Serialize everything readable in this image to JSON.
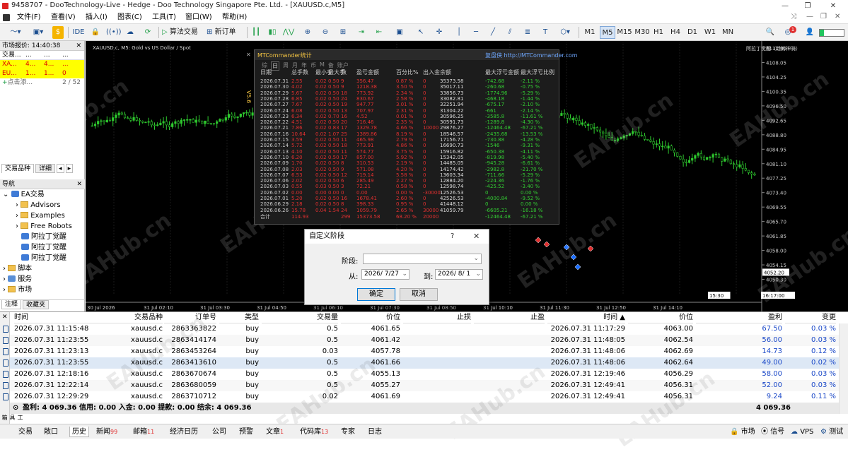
{
  "window": {
    "title": "9458707 - DooTechnology-Live - Hedge - Doo Technology Singapore Pte. Ltd. - [XAUUSD.c,M5]"
  },
  "menu": [
    "文件(F)",
    "查看(V)",
    "插入(I)",
    "图表(C)",
    "工具(T)",
    "窗口(W)",
    "帮助(H)"
  ],
  "toolbar": {
    "ide": "IDE",
    "algo_trading": "算法交易",
    "new_order": "新订单",
    "timeframes": [
      "M1",
      "M5",
      "M15",
      "M30",
      "H1",
      "H4",
      "D1",
      "W1",
      "MN"
    ],
    "active_timeframe": "M5",
    "notify_count": "1"
  },
  "market_watch": {
    "title": "市场报价: 14:40:38",
    "headers": [
      "交易...",
      "...",
      "...",
      "..."
    ],
    "rows": [
      {
        "symbol": "XA...",
        "bid": "4...",
        "ask": "4...",
        "spread": "..."
      },
      {
        "symbol": "EU...",
        "bid": "1...",
        "ask": "1...",
        "spread": "0"
      }
    ],
    "add": "点击添...",
    "count": "2 / 52",
    "tabs": [
      "交易品种",
      "详细"
    ]
  },
  "navigator": {
    "title": "导航",
    "items": [
      "EA交易",
      "Advisors",
      "Examples",
      "Free Robots",
      "阿拉丁觉醒",
      "阿拉丁觉醒",
      "阿拉丁觉醒",
      "脚本",
      "服务",
      "市场"
    ],
    "tabs": [
      "注释",
      "收藏夹"
    ]
  },
  "chart": {
    "symbol_label": "XAUUSD.c, M5:  Gold vs US Dollar / Spot",
    "ea_label": "阿拉丁觉醒（趋势神骑）",
    "price_ticks": [
      "4111.90",
      "4108.05",
      "4104.25",
      "4100.35",
      "4096.50",
      "4092.65",
      "4088.80",
      "4084.95",
      "4081.10",
      "4077.25",
      "4073.40",
      "4069.55",
      "4065.70",
      "4061.85",
      "4058.00",
      "4054.15",
      "4050.30",
      "4046.45"
    ],
    "current_price": "4052.20",
    "time_ticks": [
      "30 Jul 2026",
      "31 Jul 02:10",
      "31 Jul 03:30",
      "31 Jul 04:50",
      "31 Jul 06:10",
      "31 Jul 07:30",
      "31 Jul 08:50",
      "31 Jul 10:10",
      "31 Jul 11:30",
      "31 Jul 12:50",
      "31 Jul 14:10"
    ],
    "time_markers": [
      "15:30",
      "16:17:00"
    ]
  },
  "mtc": {
    "title": "MTCommander统计",
    "link": "复盘侠 http://MTCommander.com",
    "tabs": [
      "综",
      "日",
      "周",
      "月",
      "年",
      "币",
      "M",
      "备",
      "账户"
    ],
    "headers": [
      "日期",
      "总手数",
      "最小手",
      "最大手",
      "数",
      "盈亏金额",
      "百分比%",
      "出入金",
      "余额",
      "最大浮亏金额",
      "最大浮亏比例"
    ],
    "rows": [
      [
        "2026.07.31",
        "2.55",
        "0.02",
        "0.50",
        "9",
        "356.47",
        "0.87 %",
        "0",
        "35373.58",
        "-742.68",
        "-2.11 %"
      ],
      [
        "2026.07.30",
        "4.02",
        "0.02",
        "0.50",
        "9",
        "1218.38",
        "3.50 %",
        "0",
        "35017.11",
        "-260.68",
        "-0.75 %"
      ],
      [
        "2026.07.29",
        "5.67",
        "0.02",
        "0.50",
        "18",
        "773.92",
        "2.34 %",
        "0",
        "33856.73",
        "-1774.96",
        "-5.29 %"
      ],
      [
        "2026.07.28",
        "6.85",
        "0.02",
        "0.50",
        "24",
        "830.67",
        "2.58 %",
        "0",
        "33082.81",
        "-468.18",
        "-1.44 %"
      ],
      [
        "2026.07.27",
        "7.67",
        "0.02",
        "0.50",
        "19",
        "947.77",
        "3.01 %",
        "0",
        "32251.94",
        "-675.17",
        "-2.10 %"
      ],
      [
        "2026.07.24",
        "6.08",
        "0.02",
        "0.50",
        "13",
        "707.97",
        "2.31 %",
        "0",
        "31304.22",
        "-661",
        "-2.14 %"
      ],
      [
        "2026.07.23",
        "6.34",
        "0.02",
        "0.70",
        "16",
        "4.52",
        "0.01 %",
        "0",
        "30596.25",
        "-3585.8",
        "-11.61 %"
      ],
      [
        "2026.07.22",
        "4.51",
        "0.02",
        "0.50",
        "20",
        "716.46",
        "2.35 %",
        "0",
        "30591.73",
        "-1289.8",
        "-4.30 %"
      ],
      [
        "2026.07.21",
        "7.86",
        "0.02",
        "0.83",
        "17",
        "1329.78",
        "4.66 %",
        "10000",
        "29876.27",
        "-12464.48",
        "-67.21 %"
      ],
      [
        "2026.07.16",
        "10.64",
        "0.02",
        "1.07",
        "25",
        "1389.86",
        "8.19 %",
        "0",
        "18546.57",
        "-2435.68",
        "-13.53 %"
      ],
      [
        "2026.07.15",
        "3.59",
        "0.02",
        "0.50",
        "11",
        "465.98",
        "2.79 %",
        "0",
        "17156.71",
        "-730.88",
        "-4.28 %"
      ],
      [
        "2026.07.14",
        "5.72",
        "0.02",
        "0.50",
        "18",
        "773.91",
        "4.86 %",
        "0",
        "16690.73",
        "-1546",
        "-9.31 %"
      ],
      [
        "2026.07.13",
        "4.10",
        "0.02",
        "0.50",
        "11",
        "574.77",
        "3.75 %",
        "0",
        "15916.82",
        "-650.38",
        "-4.11 %"
      ],
      [
        "2026.07.10",
        "6.20",
        "0.02",
        "0.50",
        "17",
        "857.00",
        "5.92 %",
        "0",
        "15342.05",
        "-819.98",
        "-5.40 %"
      ],
      [
        "2026.07.09",
        "1.70",
        "0.02",
        "0.50",
        "8",
        "310.53",
        "2.19 %",
        "0",
        "14485.05",
        "-945.28",
        "-6.61 %"
      ],
      [
        "2026.07.08",
        "2.03",
        "0.02",
        "0.50",
        "9",
        "571.08",
        "4.20 %",
        "0",
        "14174.42",
        "-2982.8",
        "-21.70 %"
      ],
      [
        "2026.07.07",
        "6.53",
        "0.02",
        "0.50",
        "12",
        "719.14",
        "5.58 %",
        "0",
        "13603.34",
        "-711.66",
        "-5.29 %"
      ],
      [
        "2026.07.06",
        "2.02",
        "0.02",
        "0.50",
        "6",
        "285.49",
        "2.27 %",
        "0",
        "12884.20",
        "-224.36",
        "-1.76 %"
      ],
      [
        "2026.07.03",
        "0.55",
        "0.03",
        "0.50",
        "3",
        "72.21",
        "0.58 %",
        "0",
        "12598.74",
        "-425.52",
        "-3.40 %"
      ],
      [
        "2026.07.02",
        "0.00",
        "0.00",
        "0.00",
        "0",
        "0.00",
        "0.00 %",
        "-30000",
        "12526.53",
        "0",
        "0.00 %"
      ],
      [
        "2026.07.01",
        "5.20",
        "0.02",
        "0.50",
        "16",
        "1678.41",
        "2.60 %",
        "0",
        "42526.53",
        "-4000.84",
        "-9.52 %"
      ],
      [
        "2026.06.29",
        "2.18",
        "0.02",
        "0.50",
        "8",
        "398.33",
        "0.95 %",
        "0",
        "41448.12",
        "0",
        "0.00 %"
      ],
      [
        "2026.06.26",
        "15.78",
        "0.04",
        "1.54",
        "24",
        "1059.79",
        "2.65 %",
        "30000",
        "41059.79",
        "-6605.21",
        "-16.18 %"
      ]
    ],
    "total": [
      "合计",
      "114.93",
      "",
      "",
      "299",
      "15373.58",
      "68.20 %",
      "20000",
      "",
      "-12464.48",
      "-67.21 %"
    ]
  },
  "dialog": {
    "title": "自定义阶段",
    "help": "?",
    "stage_label": "阶段:",
    "from_label": "从:",
    "from_value": "2026/ 7/27",
    "to_label": "到:",
    "to_value": "2026/ 8/ 1",
    "ok": "确定",
    "cancel": "取消"
  },
  "history": {
    "headers": [
      "时间",
      "交易品种",
      "订单号",
      "类型",
      "交易量",
      "价位",
      "止损",
      "止盈",
      "时间 ▲",
      "价位",
      "盈利",
      "变更"
    ],
    "rows": [
      [
        "2026.07.31 11:15:48",
        "xauusd.c",
        "2863363822",
        "buy",
        "0.5",
        "4061.65",
        "",
        "",
        "2026.07.31 11:17:29",
        "4063.00",
        "67.50",
        "0.03 %"
      ],
      [
        "2026.07.31 11:23:55",
        "xauusd.c",
        "2863414174",
        "buy",
        "0.5",
        "4061.42",
        "",
        "",
        "2026.07.31 11:48:05",
        "4062.54",
        "56.00",
        "0.03 %"
      ],
      [
        "2026.07.31 11:23:13",
        "xauusd.c",
        "2863453264",
        "buy",
        "0.03",
        "4057.78",
        "",
        "",
        "2026.07.31 11:48:06",
        "4062.69",
        "14.73",
        "0.12 %"
      ],
      [
        "2026.07.31 11:23:55",
        "xauusd.c",
        "2863413610",
        "buy",
        "0.5",
        "4061.66",
        "",
        "",
        "2026.07.31 11:48:06",
        "4062.64",
        "49.00",
        "0.02 %"
      ],
      [
        "2026.07.31 12:18:16",
        "xauusd.c",
        "2863670674",
        "buy",
        "0.5",
        "4055.13",
        "",
        "",
        "2026.07.31 12:19:46",
        "4056.29",
        "58.00",
        "0.03 %"
      ],
      [
        "2026.07.31 12:22:14",
        "xauusd.c",
        "2863680059",
        "buy",
        "0.5",
        "4055.27",
        "",
        "",
        "2026.07.31 12:49:41",
        "4056.31",
        "52.00",
        "0.03 %"
      ],
      [
        "2026.07.31 12:29:29",
        "xauusd.c",
        "2863710712",
        "buy",
        "0.02",
        "4061.69",
        "",
        "",
        "2026.07.31 12:49:41",
        "4056.31",
        "9.24",
        "0.11 %"
      ]
    ],
    "summary": "盈利: 4 069.36  信用: 0.00  入金: 0.00  提款: 0.00  结余: 4 069.36",
    "summary_total": "4 069.36",
    "side_label": "工具箱"
  },
  "bottom_tabs": [
    {
      "label": "交易"
    },
    {
      "label": "敞口"
    },
    {
      "label": "历史"
    },
    {
      "label": "新闻",
      "badge": "99"
    },
    {
      "label": "邮箱",
      "badge": "11"
    },
    {
      "label": "经济日历"
    },
    {
      "label": "公司"
    },
    {
      "label": "预警"
    },
    {
      "label": "文章",
      "badge": "1"
    },
    {
      "label": "代码库",
      "badge": "13"
    },
    {
      "label": "专家"
    },
    {
      "label": "日志"
    }
  ],
  "status_right": [
    "市场",
    "信号",
    "VPS",
    "测试"
  ],
  "colors": {
    "profit_blue": "#1a48c8",
    "loss_red": "#e03030",
    "accent_green": "#22c55e",
    "chart_bg": "#000000"
  }
}
